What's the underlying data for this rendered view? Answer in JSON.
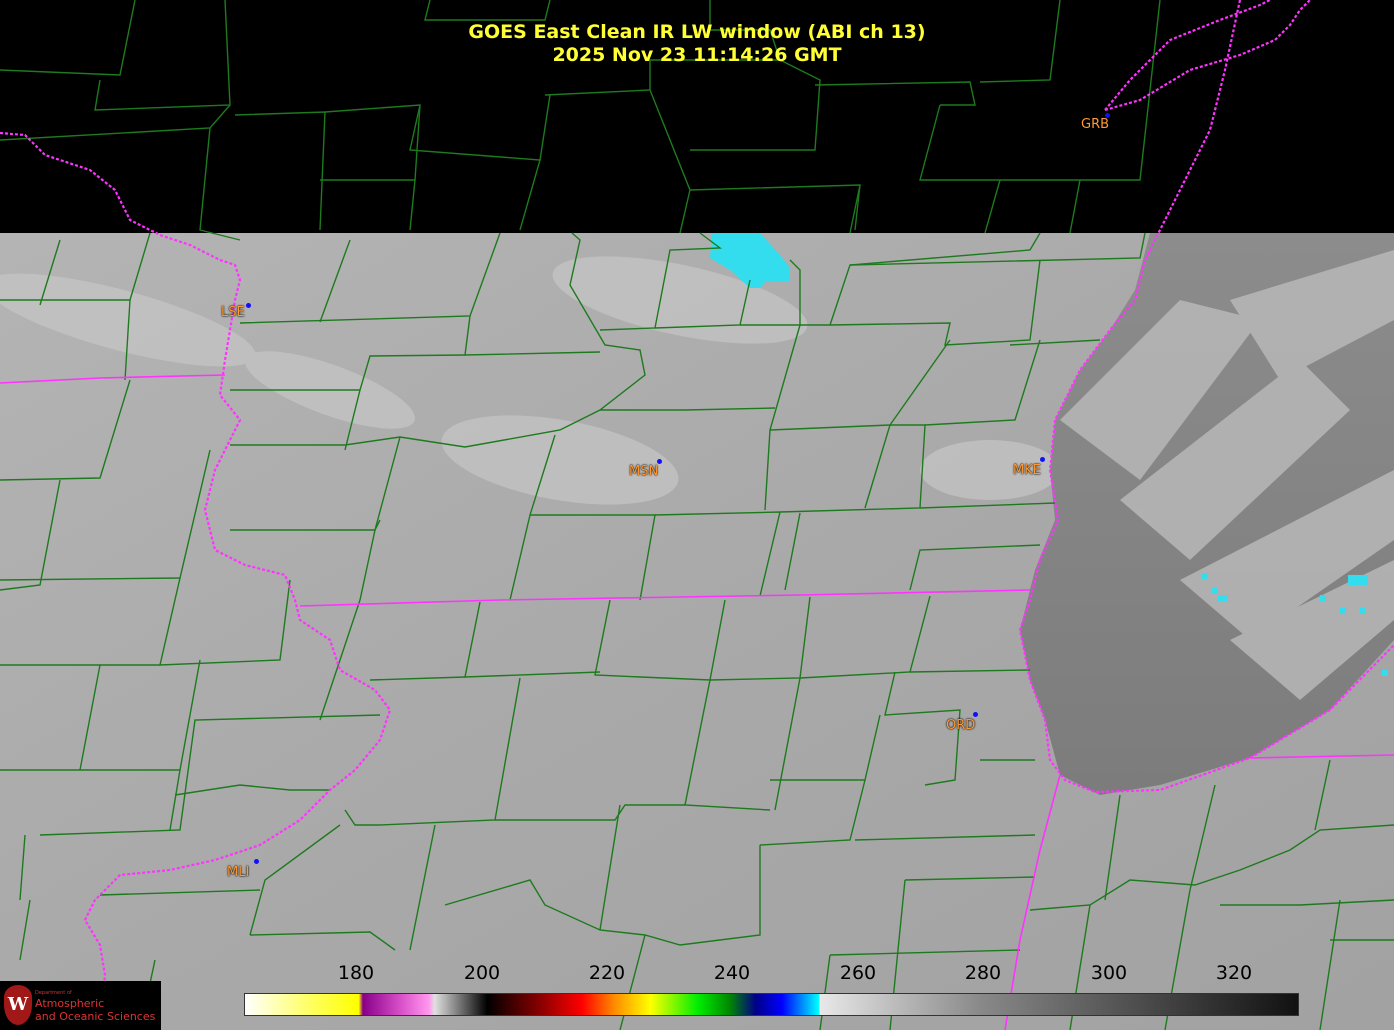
{
  "title": {
    "line1": "GOES East Clean IR LW window (ABI ch 13)",
    "line2": "2025 Nov 23  11:14:26 GMT"
  },
  "stations": [
    {
      "id": "LSE",
      "label": "LSE"
    },
    {
      "id": "MSN",
      "label": "MSN"
    },
    {
      "id": "MKE",
      "label": "MKE"
    },
    {
      "id": "GRB",
      "label": "GRB"
    },
    {
      "id": "ORD",
      "label": "ORD"
    },
    {
      "id": "MLI",
      "label": "MLI"
    }
  ],
  "colorbar": {
    "ticks": [
      "180",
      "200",
      "220",
      "240",
      "260",
      "280",
      "300",
      "320"
    ],
    "range": [
      163,
      330
    ]
  },
  "colors": {
    "county_lines": "#1e7a1e",
    "state_lines": "#ff33ff",
    "title_text": "#ffff33",
    "station_label": "#ff9933",
    "station_dot": "#1010ff",
    "no_data": "#000000",
    "cold_cloud": "#33ddee"
  },
  "logo": {
    "dept": "Department of",
    "line1": "Atmospheric",
    "line2": "and Oceanic Sciences",
    "seal": "W"
  }
}
